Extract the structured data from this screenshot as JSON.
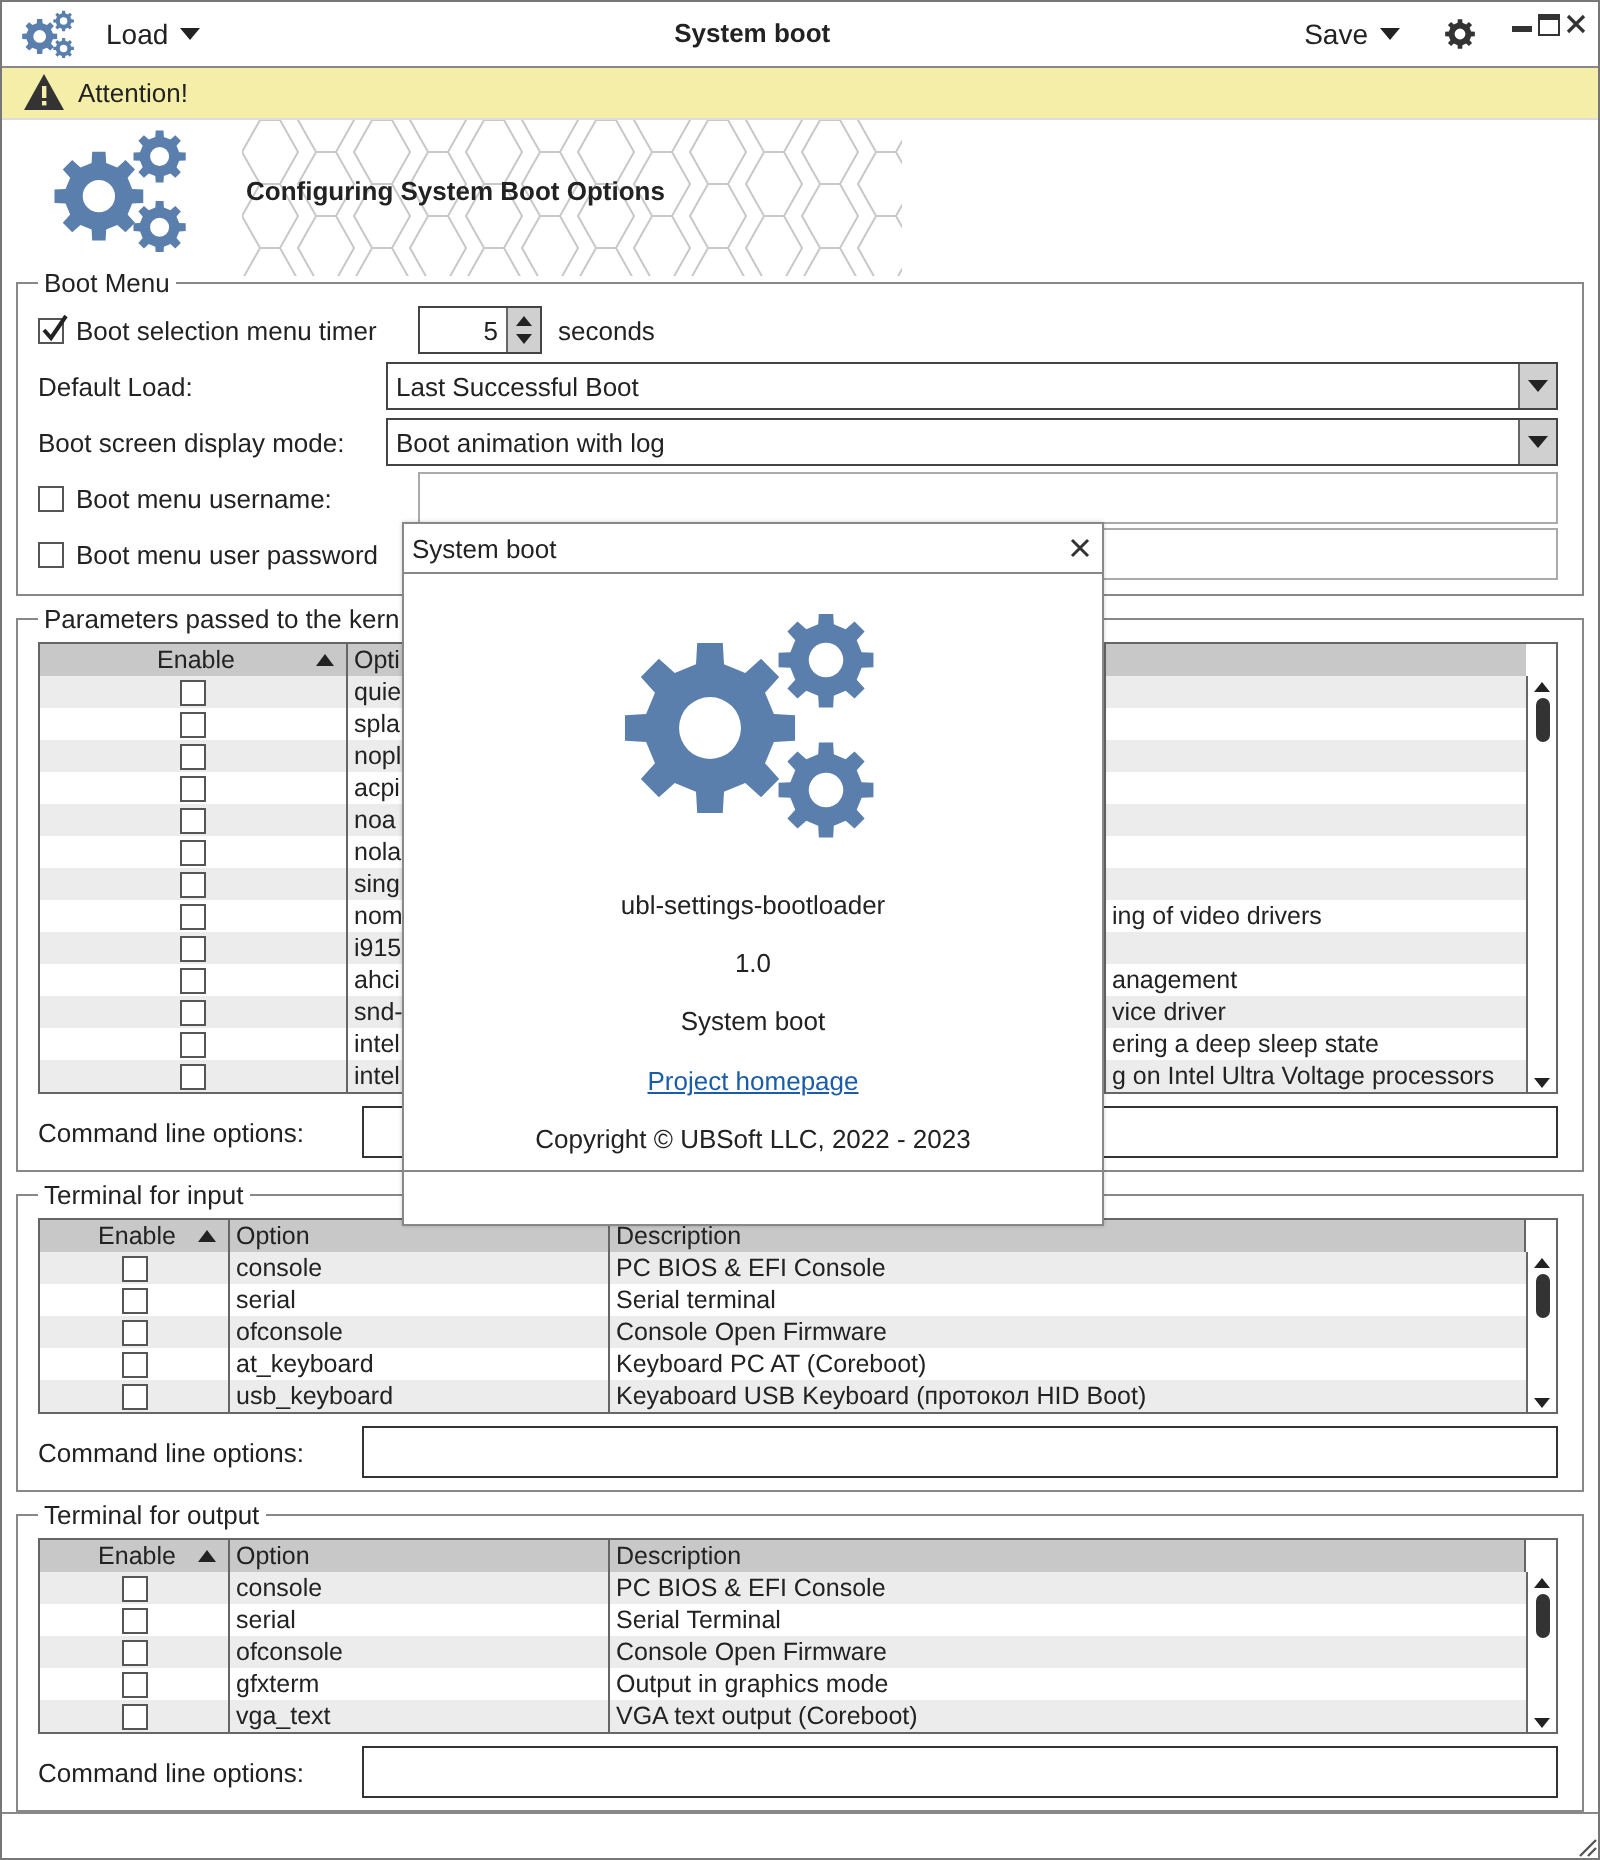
{
  "window": {
    "title": "System boot",
    "menus": [
      {
        "label": "Load"
      },
      {
        "label": "Save"
      }
    ]
  },
  "notice": {
    "text": "Attention!"
  },
  "header": {
    "title": "Configuring System Boot Options"
  },
  "boot_menu": {
    "legend": "Boot Menu",
    "timer": {
      "label": "Boot selection menu timer",
      "checked": true,
      "value": "5",
      "unit": "seconds"
    },
    "default_load": {
      "label": "Default Load:",
      "value": "Last Successful Boot"
    },
    "display_mode": {
      "label": "Boot screen display mode:",
      "value": "Boot animation with log"
    },
    "username": {
      "label": "Boot menu username:",
      "checked": false
    },
    "password": {
      "label": "Boot menu user password",
      "checked": false
    }
  },
  "sections": [
    {
      "kind": "kernel",
      "legend": "Parameters passed to the kern",
      "columns": [
        "Enable",
        "Opti"
      ],
      "command_label": "Command line options:",
      "rows": [
        {
          "enabled": false,
          "option": "quie",
          "description": ""
        },
        {
          "enabled": false,
          "option": "spla",
          "description": ""
        },
        {
          "enabled": false,
          "option": "nopl",
          "description": ""
        },
        {
          "enabled": false,
          "option": "acpi",
          "description": ""
        },
        {
          "enabled": false,
          "option": "noa",
          "description": ""
        },
        {
          "enabled": false,
          "option": "nola",
          "description": ""
        },
        {
          "enabled": false,
          "option": "sing",
          "description": ""
        },
        {
          "enabled": false,
          "option": "nom",
          "description": "ing of video drivers"
        },
        {
          "enabled": false,
          "option": "i915",
          "description": ""
        },
        {
          "enabled": false,
          "option": "ahci",
          "description": "anagement"
        },
        {
          "enabled": false,
          "option": "snd-",
          "description": "vice driver"
        },
        {
          "enabled": false,
          "option": "intel",
          "description": "ering a deep sleep state"
        },
        {
          "enabled": false,
          "option": "intel",
          "description": "g on Intel Ultra Voltage processors"
        }
      ]
    },
    {
      "kind": "terminal",
      "legend": "Terminal for input",
      "columns": [
        "Enable",
        "Option",
        "Description"
      ],
      "command_label": "Command line options:",
      "rows": [
        {
          "enabled": false,
          "option": "console",
          "description": "PC BIOS & EFI Console"
        },
        {
          "enabled": false,
          "option": "serial",
          "description": "Serial terminal"
        },
        {
          "enabled": false,
          "option": "ofconsole",
          "description": "Console Open Firmware"
        },
        {
          "enabled": false,
          "option": "at_keyboard",
          "description": "Keyboard PC AT (Coreboot)"
        },
        {
          "enabled": false,
          "option": "usb_keyboard",
          "description": "Keyaboard USB Keyboard (протокол HID Boot)"
        }
      ]
    },
    {
      "kind": "terminal",
      "legend": "Terminal for output",
      "columns": [
        "Enable",
        "Option",
        "Description"
      ],
      "command_label": "Command line options:",
      "rows": [
        {
          "enabled": false,
          "option": "console",
          "description": "PC BIOS & EFI Console"
        },
        {
          "enabled": false,
          "option": "serial",
          "description": "Serial Terminal"
        },
        {
          "enabled": false,
          "option": "ofconsole",
          "description": "Console Open Firmware"
        },
        {
          "enabled": false,
          "option": "gfxterm",
          "description": "Output in graphics mode"
        },
        {
          "enabled": false,
          "option": "vga_text",
          "description": "VGA text output (Coreboot)"
        }
      ]
    }
  ],
  "dialog": {
    "title": "System boot",
    "app_name": "ubl-settings-bootloader",
    "version": "1.0",
    "description": "System boot",
    "link": "Project homepage",
    "copyright": "Copyright © UBSoft LLC, 2022 - 2023"
  }
}
